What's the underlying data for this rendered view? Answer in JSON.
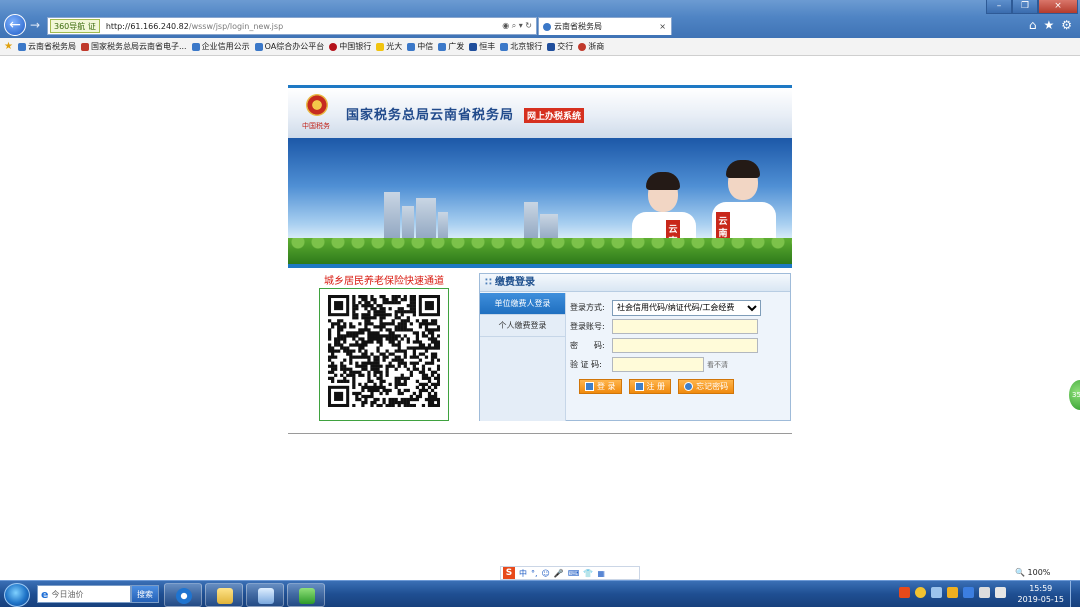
{
  "browser": {
    "engine_label": "360导航",
    "engine_badge": "证",
    "url_main": "http://61.166.240.82",
    "url_path": "/wssw/jsp/login_new.jsp",
    "url_tools": "◉ ⌕ ▾ ↻",
    "tab_title": "云南省税务局",
    "tab_close": "×",
    "window_buttons": [
      "–",
      "❐",
      "×"
    ],
    "chrome_icons": [
      "⌂",
      "★",
      "⚙"
    ],
    "back_glyph": "←",
    "forward_glyph": "→",
    "bookmarks": [
      {
        "label": "云南省税务局",
        "color": "#3b78c8"
      },
      {
        "label": "国家税务总局云南省电子...",
        "color": "#c0392b"
      },
      {
        "label": "企业信用公示",
        "color": "#3b78c8"
      },
      {
        "label": "OA综合办公平台",
        "color": "#3b78c8"
      },
      {
        "label": "中国银行",
        "color": "#b5121b"
      },
      {
        "label": "光大",
        "color": "#f1c40f"
      },
      {
        "label": "中信",
        "color": "#3b78c8"
      },
      {
        "label": "广发",
        "color": "#3b78c8"
      },
      {
        "label": "恒丰",
        "color": "#1f4e9c"
      },
      {
        "label": "北京银行",
        "color": "#3b78c8"
      },
      {
        "label": "交行",
        "color": "#1f4e9c"
      },
      {
        "label": "浙商",
        "color": "#c0392b"
      }
    ]
  },
  "header": {
    "emblem_caption": "中国税务",
    "title": "国家税务总局云南省税务局",
    "subtitle": "网上办税系统",
    "sash_text": "云南税务"
  },
  "qr": {
    "title": "城乡居民养老保险快速通道"
  },
  "login": {
    "panel_title": "缴费登录",
    "tabs": [
      "单位缴费人登录",
      "个人缴费登录"
    ],
    "fields": {
      "mode_label": "登录方式:",
      "mode_value": "社会信用代码/纳证代码/工会经费",
      "account_label": "登录账号:",
      "password_label": "密　　码:",
      "captcha_label": "验 证 码:",
      "captcha_hint": "看不清"
    },
    "buttons": {
      "login": "登 录",
      "register": "注 册",
      "forgot": "忘记密码"
    }
  },
  "float_badge": "35",
  "ime": {
    "logo": "S",
    "items": [
      "中",
      "°,",
      "☺",
      "🎤",
      "⌨",
      "👕",
      "▦"
    ]
  },
  "status": {
    "zoom": "100%"
  },
  "taskbar": {
    "search_placeholder": "今日油价",
    "search_button": "搜索",
    "clock_time": "15:59",
    "clock_date": "2019-05-15"
  }
}
